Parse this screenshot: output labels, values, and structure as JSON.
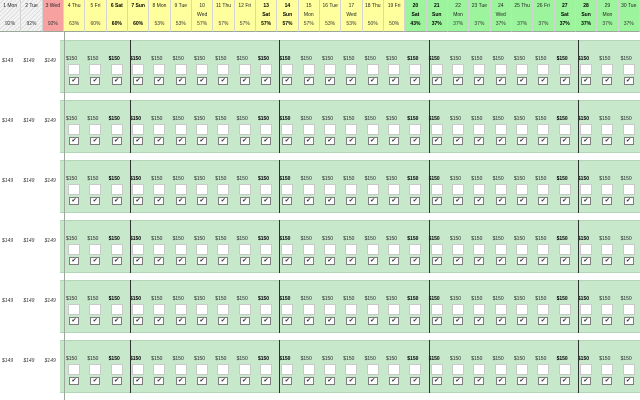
{
  "columns": [
    {
      "l1": "1 Mon",
      "l2": "",
      "l3": "92%",
      "bg": "hatch",
      "bold": false
    },
    {
      "l1": "2 Tue",
      "l2": "",
      "l3": "92%",
      "bg": "hatch",
      "bold": false
    },
    {
      "l1": "3 Wed",
      "l2": "",
      "l3": "92%",
      "bg": "#f7a1a1",
      "bold": false
    },
    {
      "l1": "4 Thu",
      "l2": "",
      "l3": "63%",
      "bg": "#ffff9e",
      "bold": false
    },
    {
      "l1": "5 Fri",
      "l2": "",
      "l3": "60%",
      "bg": "#ffff9e",
      "bold": false
    },
    {
      "l1": "6 Sat",
      "l2": "",
      "l3": "60%",
      "bg": "#ffff9e",
      "bold": true
    },
    {
      "l1": "7 Sun",
      "l2": "",
      "l3": "60%",
      "bg": "#ffff9e",
      "bold": true
    },
    {
      "l1": "8 Mon",
      "l2": "",
      "l3": "53%",
      "bg": "#ffff9e",
      "bold": false
    },
    {
      "l1": "9 Tue",
      "l2": "",
      "l3": "53%",
      "bg": "#ffff9e",
      "bold": false
    },
    {
      "l1": "10",
      "l2": "Wed",
      "l3": "57%",
      "bg": "#ffff9e",
      "bold": false
    },
    {
      "l1": "11 Thu",
      "l2": "",
      "l3": "57%",
      "bg": "#ffff9e",
      "bold": false
    },
    {
      "l1": "12 Fri",
      "l2": "",
      "l3": "57%",
      "bg": "#ffff9e",
      "bold": false
    },
    {
      "l1": "13",
      "l2": "Sat",
      "l3": "57%",
      "bg": "#ffff9e",
      "bold": true
    },
    {
      "l1": "14",
      "l2": "Sun",
      "l3": "57%",
      "bg": "#ffff9e",
      "bold": true
    },
    {
      "l1": "15",
      "l2": "Mon",
      "l3": "57%",
      "bg": "#ffff9e",
      "bold": false
    },
    {
      "l1": "16 Tue",
      "l2": "",
      "l3": "53%",
      "bg": "#ffff9e",
      "bold": false
    },
    {
      "l1": "17",
      "l2": "Wed",
      "l3": "53%",
      "bg": "#ffff9e",
      "bold": false
    },
    {
      "l1": "18 Thu",
      "l2": "",
      "l3": "50%",
      "bg": "#ffff9e",
      "bold": false
    },
    {
      "l1": "19 Fri",
      "l2": "",
      "l3": "50%",
      "bg": "#ffff9e",
      "bold": false
    },
    {
      "l1": "20",
      "l2": "Sat",
      "l3": "43%",
      "bg": "#9cf59c",
      "bold": true
    },
    {
      "l1": "21",
      "l2": "Sun",
      "l3": "37%",
      "bg": "#9cf59c",
      "bold": true
    },
    {
      "l1": "22",
      "l2": "Mon",
      "l3": "37%",
      "bg": "#9cf59c",
      "bold": false
    },
    {
      "l1": "23 Tue",
      "l2": "",
      "l3": "37%",
      "bg": "#9cf59c",
      "bold": false
    },
    {
      "l1": "24",
      "l2": "Wed",
      "l3": "37%",
      "bg": "#9cf59c",
      "bold": false
    },
    {
      "l1": "25 Thu",
      "l2": "",
      "l3": "37%",
      "bg": "#9cf59c",
      "bold": false
    },
    {
      "l1": "26 Fri",
      "l2": "",
      "l3": "37%",
      "bg": "#9cf59c",
      "bold": false
    },
    {
      "l1": "27",
      "l2": "Sat",
      "l3": "37%",
      "bg": "#9cf59c",
      "bold": true
    },
    {
      "l1": "28",
      "l2": "Sun",
      "l3": "37%",
      "bg": "#9cf59c",
      "bold": true
    },
    {
      "l1": "29",
      "l2": "Mon",
      "l3": "37%",
      "bg": "#9cf59c",
      "bold": false
    },
    {
      "l1": "30 Tue",
      "l2": "",
      "l3": "37%",
      "bg": "#9cf59c",
      "bold": false
    }
  ],
  "past_prices": [
    "$149",
    "$149",
    "$149"
  ],
  "current_prices": [
    "$150",
    "$150",
    "$150",
    "$150",
    "$150",
    "$150",
    "$150",
    "$150",
    "$150",
    "$150",
    "$150",
    "$150",
    "$150",
    "$150",
    "$150",
    "$150",
    "$150",
    "$150",
    "$150",
    "$150",
    "$150",
    "$150",
    "$150",
    "$150",
    "$150",
    "$150",
    "$150"
  ],
  "rows": [
    1,
    2,
    3,
    4,
    5,
    6
  ],
  "checkmark": "✔",
  "colors": {
    "past_closed": "#f7a1a1",
    "weekday_yellow": "#ffff9e",
    "weekday_green": "#9cf59c",
    "row_band": "#c8e8cc"
  }
}
